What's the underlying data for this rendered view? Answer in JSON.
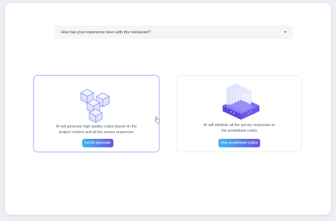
{
  "question": {
    "text": "How has your experience been with this restaurant?",
    "chevron_icon": "chevron-down-icon"
  },
  "options": {
    "ai_generate": {
      "icon": "cubes-icon",
      "description_line1": "AI will generate high quality codes based on the",
      "description_line2": "project context and all the survey responses",
      "button_label": "Let AI generate",
      "selected": true
    },
    "predefined": {
      "icon": "stacked-files-box-icon",
      "description_line1": "AI will attribute all the survey responses to",
      "description_line2": "the predefined codes",
      "button_label": "Use predefined codes",
      "selected": false
    }
  },
  "colors": {
    "accent_start": "#3fb7f0",
    "accent_end": "#6a55e6",
    "selected_border": "#b6bff0",
    "illustration_purple": "#6e5ff0"
  }
}
